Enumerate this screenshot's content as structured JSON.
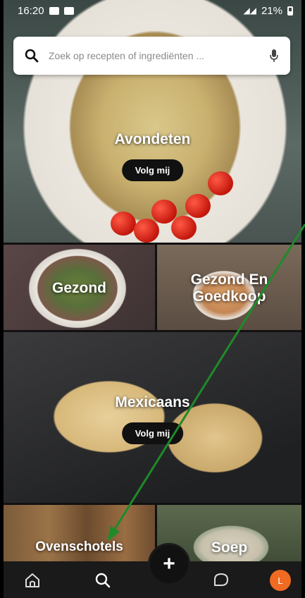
{
  "status_bar": {
    "time": "16:20",
    "battery": "21%"
  },
  "search": {
    "placeholder": "Zoek op recepten of ingrediënten ..."
  },
  "categories": {
    "avondeten": {
      "title": "Avondeten",
      "follow": "Volg mij"
    },
    "gezond": {
      "title": "Gezond"
    },
    "gezond_goedkoop": {
      "title": "Gezond En Goedkoop"
    },
    "mexicaans": {
      "title": "Mexicaans",
      "follow": "Volg mij"
    },
    "ovenschotels": {
      "title": "Ovenschotels"
    },
    "soep": {
      "title": "Soep"
    }
  },
  "nav": {
    "avatar_initial": "L",
    "add_label": "+"
  },
  "colors": {
    "accent": "#f06a22",
    "annotation": "#1f8a28"
  },
  "icons": [
    "search-icon",
    "mic-icon",
    "home-icon",
    "search-nav-icon",
    "add-icon",
    "chat-icon"
  ]
}
